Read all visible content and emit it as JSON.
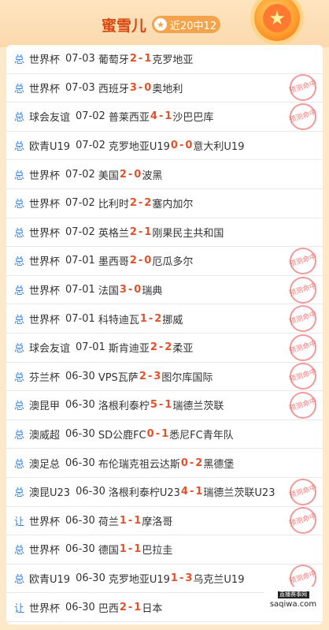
{
  "header": {
    "name": "蜜雪儿",
    "record": "近20中12",
    "star_glyph": "★",
    "medal_glyph": "★"
  },
  "stamp_text": "预测命中",
  "rows": [
    {
      "type": "总",
      "league": "世界杯",
      "date": "07-03",
      "home": "葡萄牙",
      "hs": "2",
      "sep": "-",
      "as": "1",
      "away": "克罗地亚",
      "hit": false
    },
    {
      "type": "总",
      "league": "世界杯",
      "date": "07-03",
      "home": "西班牙",
      "hs": "3",
      "sep": "-",
      "as": "0",
      "away": "奥地利",
      "hit": true
    },
    {
      "type": "总",
      "league": "球会友谊",
      "date": "07-02",
      "home": "普莱西亚",
      "hs": "4",
      "sep": "-",
      "as": "1",
      "away": "沙巴巴库",
      "hit": true
    },
    {
      "type": "总",
      "league": "欧青U19",
      "date": "07-02",
      "home": "克罗地亚U19",
      "hs": "0",
      "sep": "-",
      "as": "0",
      "away": "意大利U19",
      "hit": false
    },
    {
      "type": "总",
      "league": "世界杯",
      "date": "07-02",
      "home": "美国",
      "hs": "2",
      "sep": "-",
      "as": "0",
      "away": "波黑",
      "hit": false
    },
    {
      "type": "总",
      "league": "世界杯",
      "date": "07-02",
      "home": "比利时",
      "hs": "2",
      "sep": "-",
      "as": "2",
      "away": "塞内加尔",
      "hit": false
    },
    {
      "type": "总",
      "league": "世界杯",
      "date": "07-02",
      "home": "英格兰",
      "hs": "2",
      "sep": "-",
      "as": "1",
      "away": "刚果民主共和国",
      "hit": false
    },
    {
      "type": "总",
      "league": "世界杯",
      "date": "07-01",
      "home": "墨西哥",
      "hs": "2",
      "sep": "-",
      "as": "0",
      "away": "厄瓜多尔",
      "hit": true
    },
    {
      "type": "总",
      "league": "世界杯",
      "date": "07-01",
      "home": "法国",
      "hs": "3",
      "sep": "-",
      "as": "0",
      "away": "瑞典",
      "hit": true
    },
    {
      "type": "总",
      "league": "世界杯",
      "date": "07-01",
      "home": "科特迪瓦",
      "hs": "1",
      "sep": "-",
      "as": "2",
      "away": "挪威",
      "hit": true
    },
    {
      "type": "总",
      "league": "球会友谊",
      "date": "07-01",
      "home": "斯肯迪亚",
      "hs": "2",
      "sep": "-",
      "as": "2",
      "away": "柔亚",
      "hit": true
    },
    {
      "type": "总",
      "league": "芬兰杯",
      "date": "06-30",
      "home": "VPS瓦萨",
      "hs": "2",
      "sep": "-",
      "as": "3",
      "away": "图尔库国际",
      "hit": true
    },
    {
      "type": "总",
      "league": "澳昆甲",
      "date": "06-30",
      "home": "洛根利泰柠",
      "hs": "5",
      "sep": "-",
      "as": "1",
      "away": "瑞德兰茨联",
      "hit": true
    },
    {
      "type": "总",
      "league": "澳威超",
      "date": "06-30",
      "home": "SD公鹿FC",
      "hs": "0",
      "sep": "-",
      "as": "1",
      "away": "悉尼FC青年队",
      "hit": false
    },
    {
      "type": "总",
      "league": "澳足总",
      "date": "06-30",
      "home": "布伦瑞克祖云达斯",
      "hs": "0",
      "sep": "-",
      "as": "2",
      "away": "黑德堡",
      "hit": false
    },
    {
      "type": "总",
      "league": "澳昆U23",
      "date": "06-30",
      "home": "洛根利泰柠U23",
      "hs": "4",
      "sep": "-",
      "as": "1",
      "away": "瑞德兰茨联U23",
      "hit": true
    },
    {
      "type": "让",
      "league": "世界杯",
      "date": "06-30",
      "home": "荷兰",
      "hs": "1",
      "sep": "-",
      "as": "1",
      "away": "摩洛哥",
      "hit": true
    },
    {
      "type": "总",
      "league": "世界杯",
      "date": "06-30",
      "home": "德国",
      "hs": "1",
      "sep": "-",
      "as": "1",
      "away": "巴拉圭",
      "hit": false
    },
    {
      "type": "总",
      "league": "欧青U19",
      "date": "06-30",
      "home": "克罗地亚U19",
      "hs": "1",
      "sep": "-",
      "as": "3",
      "away": "乌克兰U19",
      "hit": true
    },
    {
      "type": "让",
      "league": "世界杯",
      "date": "06-30",
      "home": "巴西",
      "hs": "2",
      "sep": "-",
      "as": "1",
      "away": "日本",
      "hit": false
    }
  ],
  "watermark": {
    "logo": "直播赛事网",
    "site": "saqiwa.com"
  },
  "colors": {
    "accent": "#e4502a",
    "type": "#3b82d6",
    "stamp": "#ee7a7a",
    "badge": "#f3a44a"
  }
}
